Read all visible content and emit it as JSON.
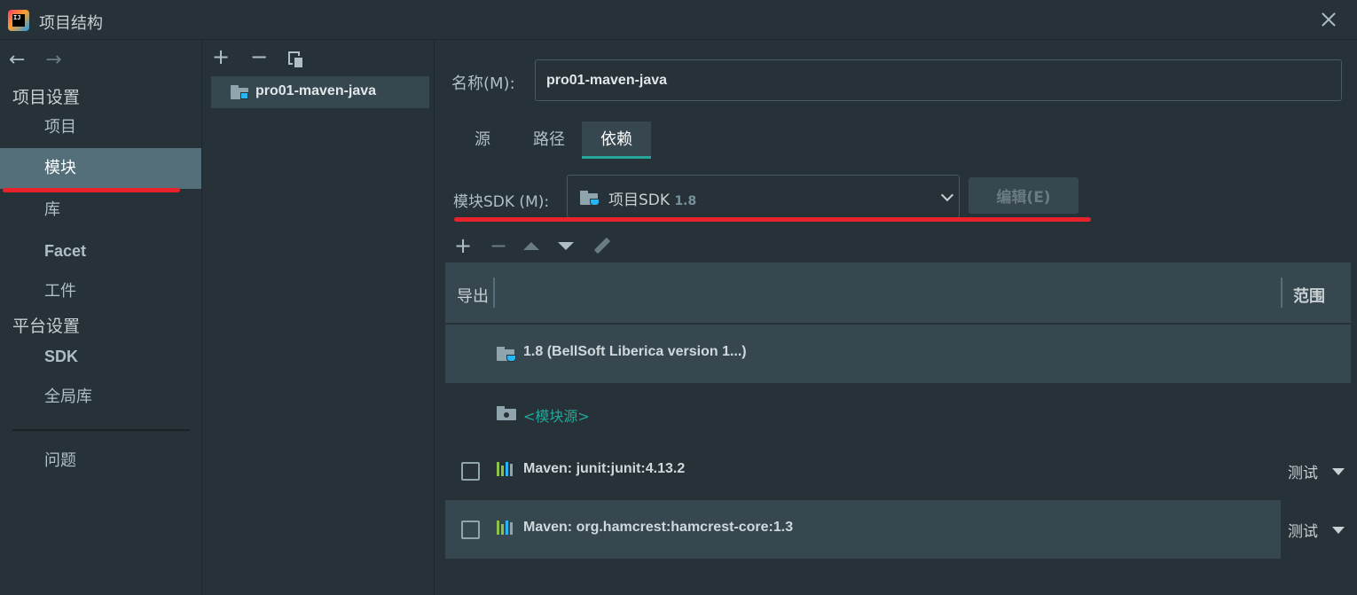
{
  "window": {
    "title": "项目结构",
    "logo_text": "IJ"
  },
  "nav": {
    "back_icon": "←",
    "forward_icon": "→",
    "project_settings_header": "项目设置",
    "platform_settings_header": "平台设置",
    "items": [
      {
        "label": "项目"
      },
      {
        "label": "模块",
        "selected": true
      },
      {
        "label": "库"
      },
      {
        "label": "Facet"
      },
      {
        "label": "工件"
      },
      {
        "label": "SDK"
      },
      {
        "label": "全局库"
      },
      {
        "label": "问题"
      }
    ]
  },
  "modules_panel": {
    "add_icon": "+",
    "remove_icon": "−",
    "module_name": "pro01-maven-java"
  },
  "module_detail": {
    "name_label": "名称(M):",
    "name_value": "pro01-maven-java",
    "tabs": [
      {
        "label": "源"
      },
      {
        "label": "路径"
      },
      {
        "label": "依赖",
        "active": true
      }
    ],
    "sdk_label": "模块SDK (M):",
    "sdk_value": "项目SDK",
    "sdk_version": "1.8",
    "edit_button": "编辑(E)"
  },
  "dependencies": {
    "toolbar": {
      "add_icon": "+",
      "remove_icon": "−"
    },
    "columns": {
      "export": "导出",
      "scope": "范围"
    },
    "rows": [
      {
        "text": "1.8 (BellSoft Liberica version 1...)",
        "kind": "sdk"
      },
      {
        "text": "<模块源>",
        "kind": "source"
      },
      {
        "text": "Maven: junit:junit:4.13.2",
        "kind": "library",
        "checked": false,
        "scope": "测试"
      },
      {
        "text": "Maven: org.hamcrest:hamcrest-core:1.3",
        "kind": "library",
        "checked": false,
        "scope": "测试",
        "selected": true
      }
    ]
  },
  "colors": {
    "background": "#263238",
    "selection": "#546e7a",
    "accent_teal": "#26a69a",
    "annotation_red": "#e8212a"
  }
}
